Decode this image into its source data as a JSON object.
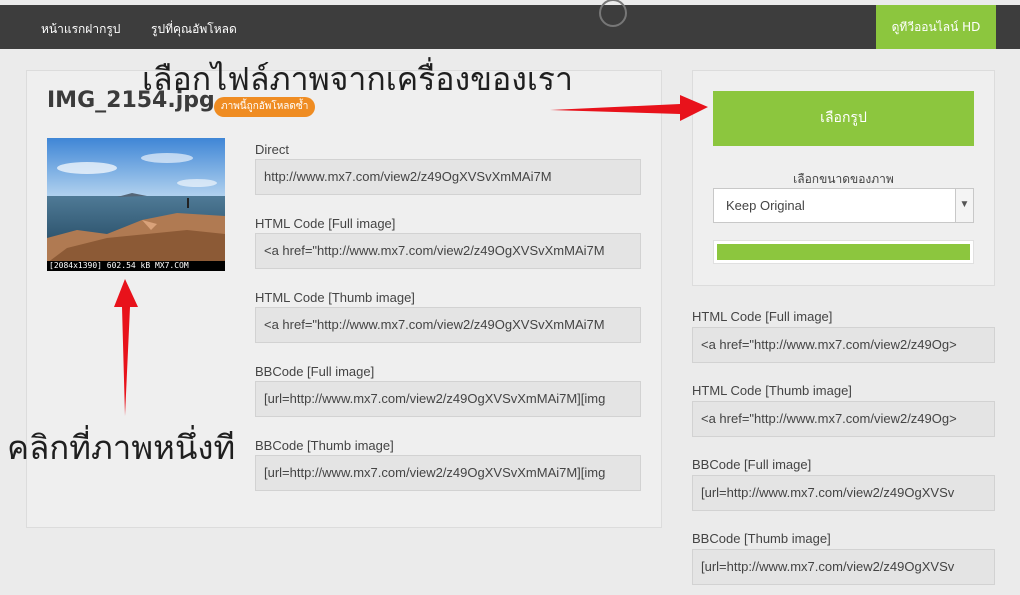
{
  "nav": {
    "home": "หน้าแรกฝากรูป",
    "my_uploads": "รูปที่คุณอัพโหลด",
    "hd_online": "ดูทีวีออนไลน์ HD"
  },
  "annotations": {
    "choose_file": "เลือกไฟล์ภาพจากเครื่องของเรา",
    "click_once": "คลิกที่ภาพหนึ่งที"
  },
  "image": {
    "filename": "IMG_2154.jpg",
    "duplicate_badge": "ภาพนี้ถูกอัพโหลดซ้ำ",
    "caption": "[2084x1390] 602.54 kB MX7.COM"
  },
  "left_fields": [
    {
      "label": "Direct",
      "value": "http://www.mx7.com/view2/z49OgXVSvXmMAi7M"
    },
    {
      "label": "HTML Code [Full image]",
      "value": "<a href=\"http://www.mx7.com/view2/z49OgXVSvXmMAi7M"
    },
    {
      "label": "HTML Code [Thumb image]",
      "value": "<a href=\"http://www.mx7.com/view2/z49OgXVSvXmMAi7M"
    },
    {
      "label": "BBCode [Full image]",
      "value": "[url=http://www.mx7.com/view2/z49OgXVSvXmMAi7M][img"
    },
    {
      "label": "BBCode [Thumb image]",
      "value": "[url=http://www.mx7.com/view2/z49OgXVSvXmMAi7M][img"
    }
  ],
  "upload": {
    "choose_button": "เลือกรูป",
    "size_label": "เลือกขนาดของภาพ",
    "size_selected": "Keep Original",
    "progress": 1.0
  },
  "right_fields": [
    {
      "label": "HTML Code [Full image]",
      "value": "<a href=\"http://www.mx7.com/view2/z49Og>"
    },
    {
      "label": "HTML Code [Thumb image]",
      "value": "<a href=\"http://www.mx7.com/view2/z49Og>"
    },
    {
      "label": "BBCode [Full image]",
      "value": "[url=http://www.mx7.com/view2/z49OgXVSv"
    },
    {
      "label": "BBCode [Thumb image]",
      "value": "[url=http://www.mx7.com/view2/z49OgXVSv"
    }
  ],
  "colors": {
    "accent_green": "#8cc63e",
    "badge_orange": "#ef8c22",
    "nav_bg": "#3d3d3d",
    "arrow_red": "#e8121b"
  }
}
